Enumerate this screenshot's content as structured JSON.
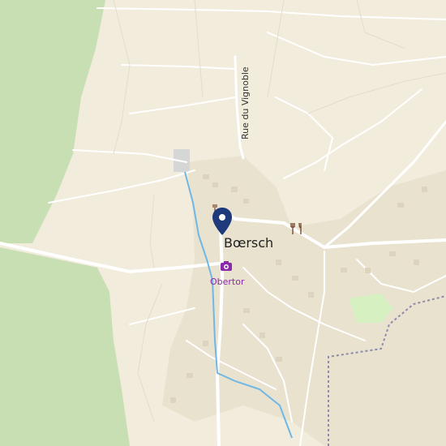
{
  "map": {
    "town_label": "Bœrsch",
    "street_label": "Rue du Vignoble",
    "poi_label": "Obertor",
    "colors": {
      "background": "#f2ecdc",
      "forest": "#c8dfb4",
      "residential": "#e8e2cf",
      "road": "#ffffff",
      "water": "#6fb8e6",
      "park": "#d7f0c2",
      "boundary": "#8b8bb0",
      "marker": "#1e3a7a",
      "poi_label": "#8a2aa8"
    },
    "icons": [
      "location-pin-icon",
      "camera-icon",
      "restaurant-icon"
    ]
  }
}
